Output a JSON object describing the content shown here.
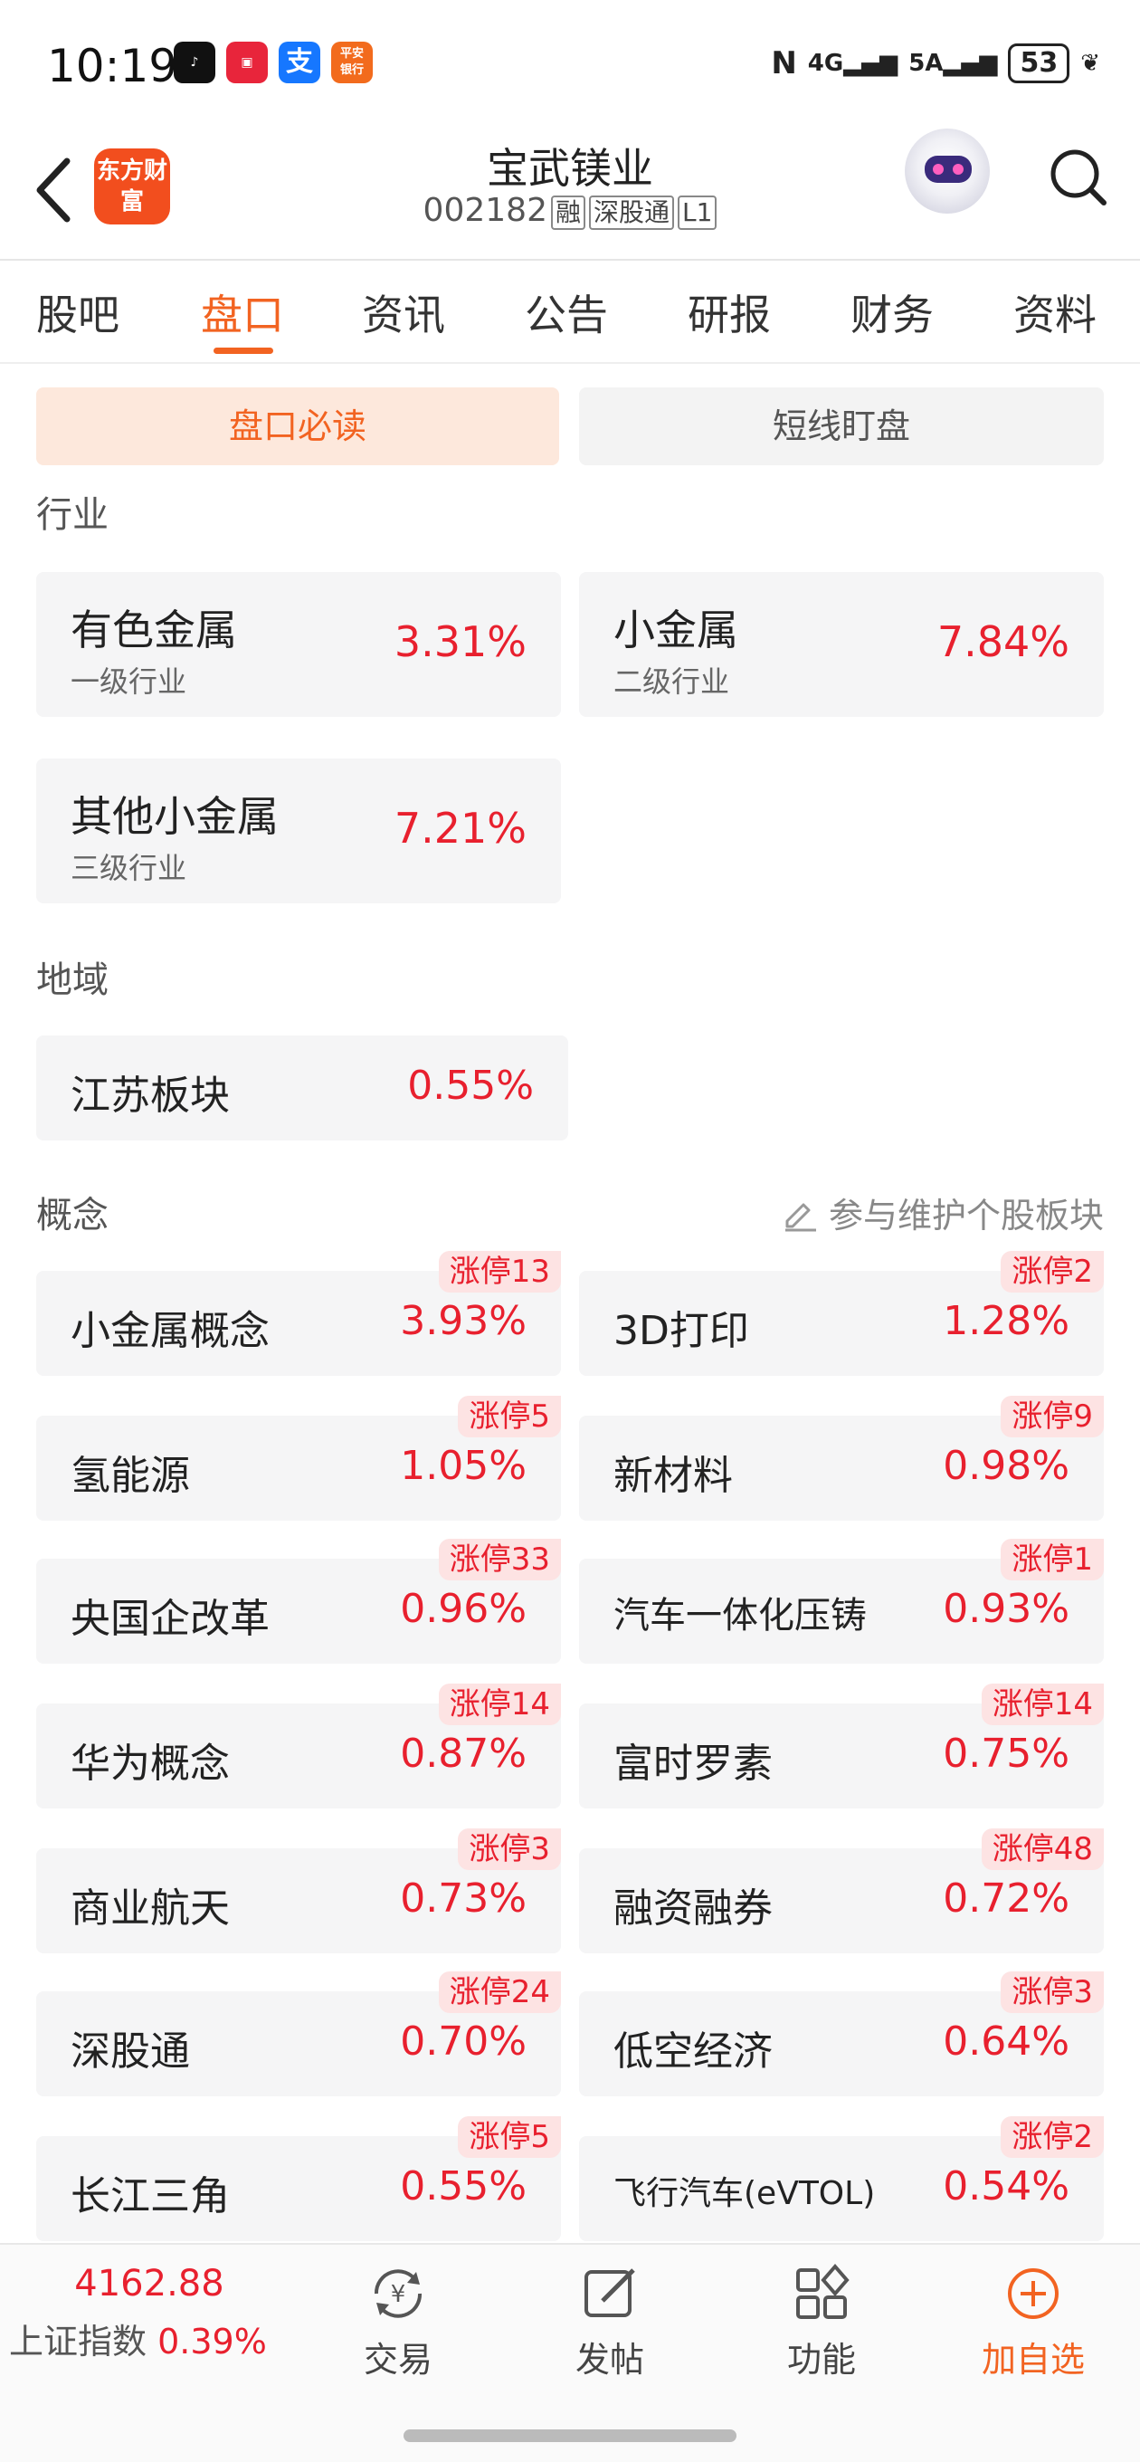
{
  "status_bar": {
    "time": "10:19",
    "network": [
      "4G",
      "5A"
    ],
    "battery": "53"
  },
  "header": {
    "logo_text": "东方财富",
    "title": "宝武镁业",
    "code": "002182",
    "tags": [
      "融",
      "深股通",
      "L1"
    ]
  },
  "tabs": [
    "股吧",
    "盘口",
    "资讯",
    "公告",
    "研报",
    "财务",
    "资料"
  ],
  "segments": {
    "active": "盘口必读",
    "other": "短线盯盘"
  },
  "industry": {
    "title": "行业",
    "items": [
      {
        "name": "有色金属",
        "level": "一级行业",
        "pct": "3.31%"
      },
      {
        "name": "小金属",
        "level": "二级行业",
        "pct": "7.84%"
      },
      {
        "name": "其他小金属",
        "level": "三级行业",
        "pct": "7.21%"
      }
    ]
  },
  "region": {
    "title": "地域",
    "items": [
      {
        "name": "江苏板块",
        "pct": "0.55%"
      }
    ]
  },
  "concept": {
    "title": "概念",
    "maintain_label": "参与维护个股板块",
    "items": [
      {
        "name": "小金属概念",
        "pct": "3.93%",
        "badge": "涨停13"
      },
      {
        "name": "3D打印",
        "pct": "1.28%",
        "badge": "涨停2"
      },
      {
        "name": "氢能源",
        "pct": "1.05%",
        "badge": "涨停5"
      },
      {
        "name": "新材料",
        "pct": "0.98%",
        "badge": "涨停9"
      },
      {
        "name": "央国企改革",
        "pct": "0.96%",
        "badge": "涨停33"
      },
      {
        "name": "汽车一体化压铸",
        "pct": "0.93%",
        "badge": "涨停1"
      },
      {
        "name": "华为概念",
        "pct": "0.87%",
        "badge": "涨停14"
      },
      {
        "name": "富时罗素",
        "pct": "0.75%",
        "badge": "涨停14"
      },
      {
        "name": "商业航天",
        "pct": "0.73%",
        "badge": "涨停3"
      },
      {
        "name": "融资融券",
        "pct": "0.72%",
        "badge": "涨停48"
      },
      {
        "name": "深股通",
        "pct": "0.70%",
        "badge": "涨停24"
      },
      {
        "name": "低空经济",
        "pct": "0.64%",
        "badge": "涨停3"
      },
      {
        "name": "长江三角",
        "pct": "0.55%",
        "badge": "涨停5"
      },
      {
        "name": "飞行汽车(eVTOL)",
        "pct": "0.54%",
        "badge": "涨停2"
      }
    ]
  },
  "bottom_bar": {
    "index_value": "4162.88",
    "index_name": "上证指数",
    "index_pct": "0.39%",
    "items": [
      "交易",
      "发帖",
      "功能",
      "加自选"
    ]
  },
  "colors": {
    "accent": "#f26321",
    "up": "#e8202e"
  }
}
